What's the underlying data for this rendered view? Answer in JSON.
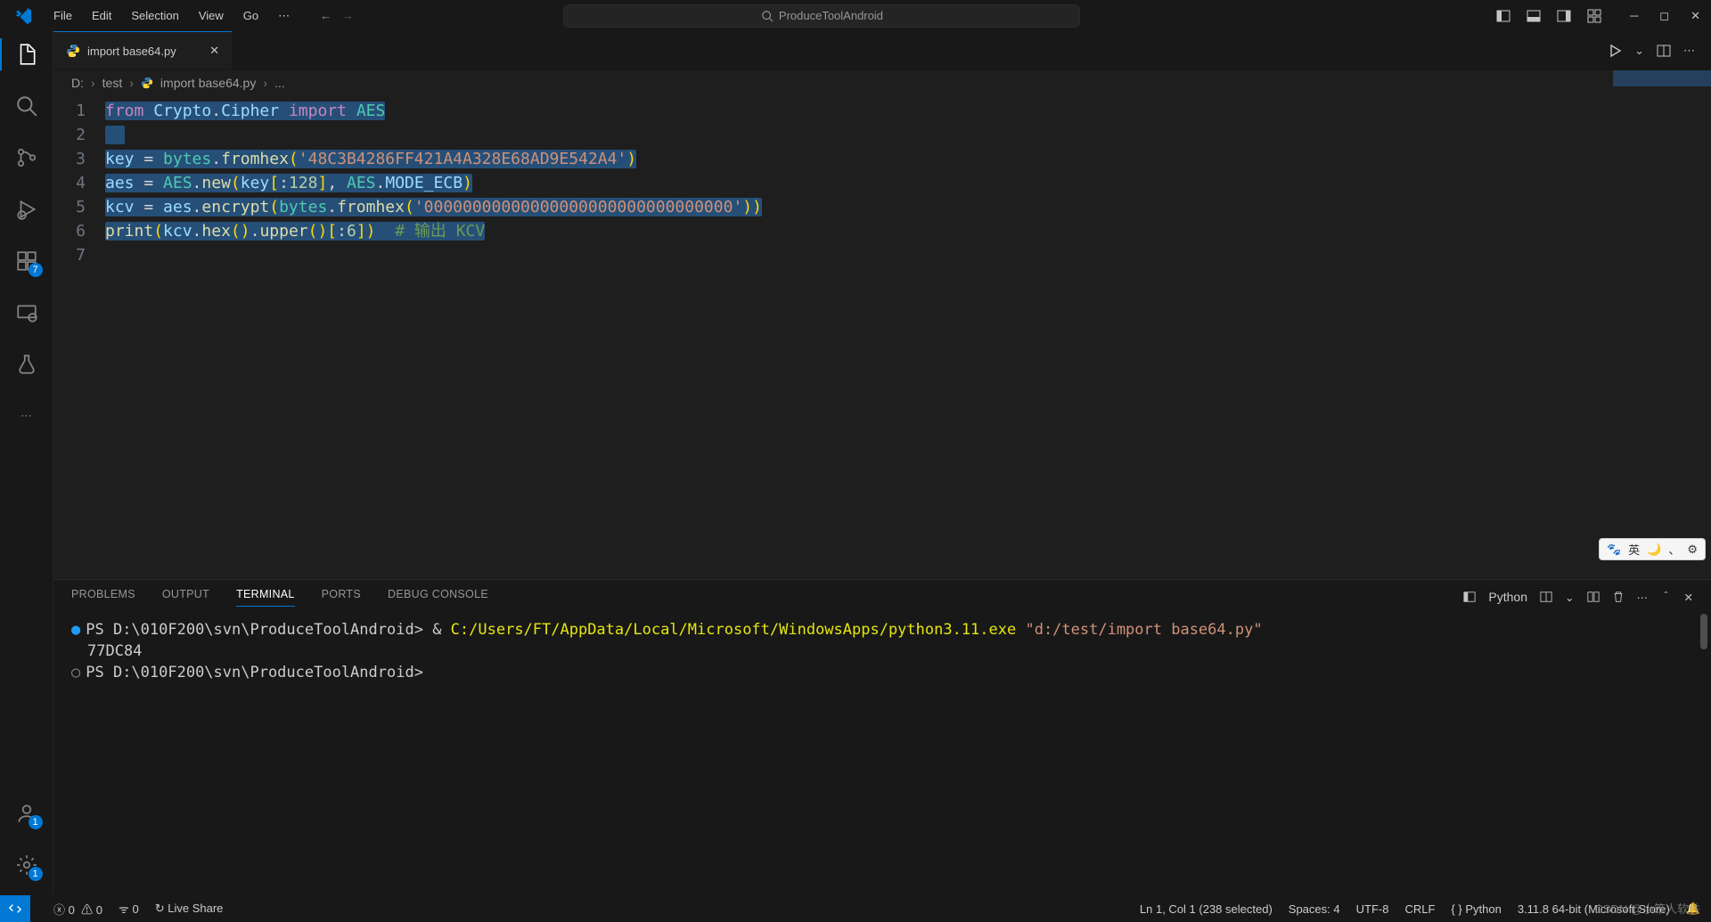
{
  "titlebar": {
    "menus": [
      "File",
      "Edit",
      "Selection",
      "View",
      "Go"
    ],
    "search_text": "ProduceToolAndroid"
  },
  "activity_bar": {
    "extensions_badge": "7",
    "accounts_badge": "1",
    "manage_badge": "1"
  },
  "tab": {
    "filename": "import base64.py",
    "icon": "🐍"
  },
  "editor_actions": {},
  "breadcrumbs": {
    "parts": [
      "D:",
      "test",
      "import base64.py",
      "..."
    ],
    "file_icon": "🐍"
  },
  "code": {
    "lines": [
      {
        "n": 1,
        "tokens": [
          [
            "kw",
            "from"
          ],
          [
            "op",
            " "
          ],
          [
            "var",
            "Crypto"
          ],
          [
            "op",
            "."
          ],
          [
            "var",
            "Cipher"
          ],
          [
            "op",
            " "
          ],
          [
            "kw",
            "import"
          ],
          [
            "op",
            " "
          ],
          [
            "cls",
            "AES"
          ]
        ]
      },
      {
        "n": 2,
        "tokens": [
          [
            "op",
            ""
          ]
        ]
      },
      {
        "n": 3,
        "tokens": [
          [
            "var",
            "key"
          ],
          [
            "op",
            " = "
          ],
          [
            "cls",
            "bytes"
          ],
          [
            "op",
            "."
          ],
          [
            "fn",
            "fromhex"
          ],
          [
            "punc",
            "("
          ],
          [
            "str",
            "'48C3B4286FF421A4A328E68AD9E542A4'"
          ],
          [
            "punc",
            ")"
          ]
        ]
      },
      {
        "n": 4,
        "tokens": [
          [
            "var",
            "aes"
          ],
          [
            "op",
            " = "
          ],
          [
            "cls",
            "AES"
          ],
          [
            "op",
            "."
          ],
          [
            "fn",
            "new"
          ],
          [
            "punc",
            "("
          ],
          [
            "var",
            "key"
          ],
          [
            "punc",
            "["
          ],
          [
            "op",
            ":"
          ],
          [
            "num",
            "128"
          ],
          [
            "punc",
            "]"
          ],
          [
            "op",
            ", "
          ],
          [
            "cls",
            "AES"
          ],
          [
            "op",
            "."
          ],
          [
            "var",
            "MODE_ECB"
          ],
          [
            "punc",
            ")"
          ]
        ]
      },
      {
        "n": 5,
        "tokens": [
          [
            "var",
            "kcv"
          ],
          [
            "op",
            " = "
          ],
          [
            "var",
            "aes"
          ],
          [
            "op",
            "."
          ],
          [
            "fn",
            "encrypt"
          ],
          [
            "punc",
            "("
          ],
          [
            "cls",
            "bytes"
          ],
          [
            "op",
            "."
          ],
          [
            "fn",
            "fromhex"
          ],
          [
            "punc",
            "("
          ],
          [
            "str",
            "'00000000000000000000000000000000'"
          ],
          [
            "punc",
            "))"
          ]
        ]
      },
      {
        "n": 6,
        "tokens": [
          [
            "fn",
            "print"
          ],
          [
            "punc",
            "("
          ],
          [
            "var",
            "kcv"
          ],
          [
            "op",
            "."
          ],
          [
            "fn",
            "hex"
          ],
          [
            "punc",
            "()"
          ],
          [
            "op",
            "."
          ],
          [
            "fn",
            "upper"
          ],
          [
            "punc",
            "()["
          ],
          [
            "op",
            ":"
          ],
          [
            "num",
            "6"
          ],
          [
            "punc",
            "])"
          ],
          [
            "op",
            "  "
          ],
          [
            "cmt",
            "# 输出 KCV"
          ]
        ]
      },
      {
        "n": 7,
        "tokens": [
          [
            "op",
            ""
          ]
        ]
      }
    ],
    "selection_lines": [
      1,
      2,
      3,
      4,
      5,
      6
    ]
  },
  "panel": {
    "tabs": [
      "PROBLEMS",
      "OUTPUT",
      "TERMINAL",
      "PORTS",
      "DEBUG CONSOLE"
    ],
    "active_tab": 2,
    "terminal_label": "Python",
    "terminal": {
      "prompt1_pre": "PS D:\\010F200\\svn\\ProduceToolAndroid> ",
      "cmd_amp": "& ",
      "cmd_exec": "C:/Users/FT/AppData/Local/Microsoft/WindowsApps/python3.11.exe",
      "cmd_arg": " \"d:/test/import base64.py\"",
      "output_line": "77DC84",
      "prompt2": "PS D:\\010F200\\svn\\ProduceToolAndroid> "
    }
  },
  "statusbar": {
    "errors": "0",
    "warnings": "0",
    "ports": "0",
    "live_share": "Live Share",
    "cursor": "Ln 1, Col 1 (238 selected)",
    "spaces": "Spaces: 4",
    "encoding": "UTF-8",
    "eol": "CRLF",
    "lang": "Python",
    "interpreter": "3.11.8 64-bit (Microsoft Store)"
  },
  "ime": {
    "chars": [
      "英",
      "🌙",
      "、",
      "⚙"
    ],
    "paw": "🐾"
  },
  "watermark": "CSDN @小笨人软件"
}
